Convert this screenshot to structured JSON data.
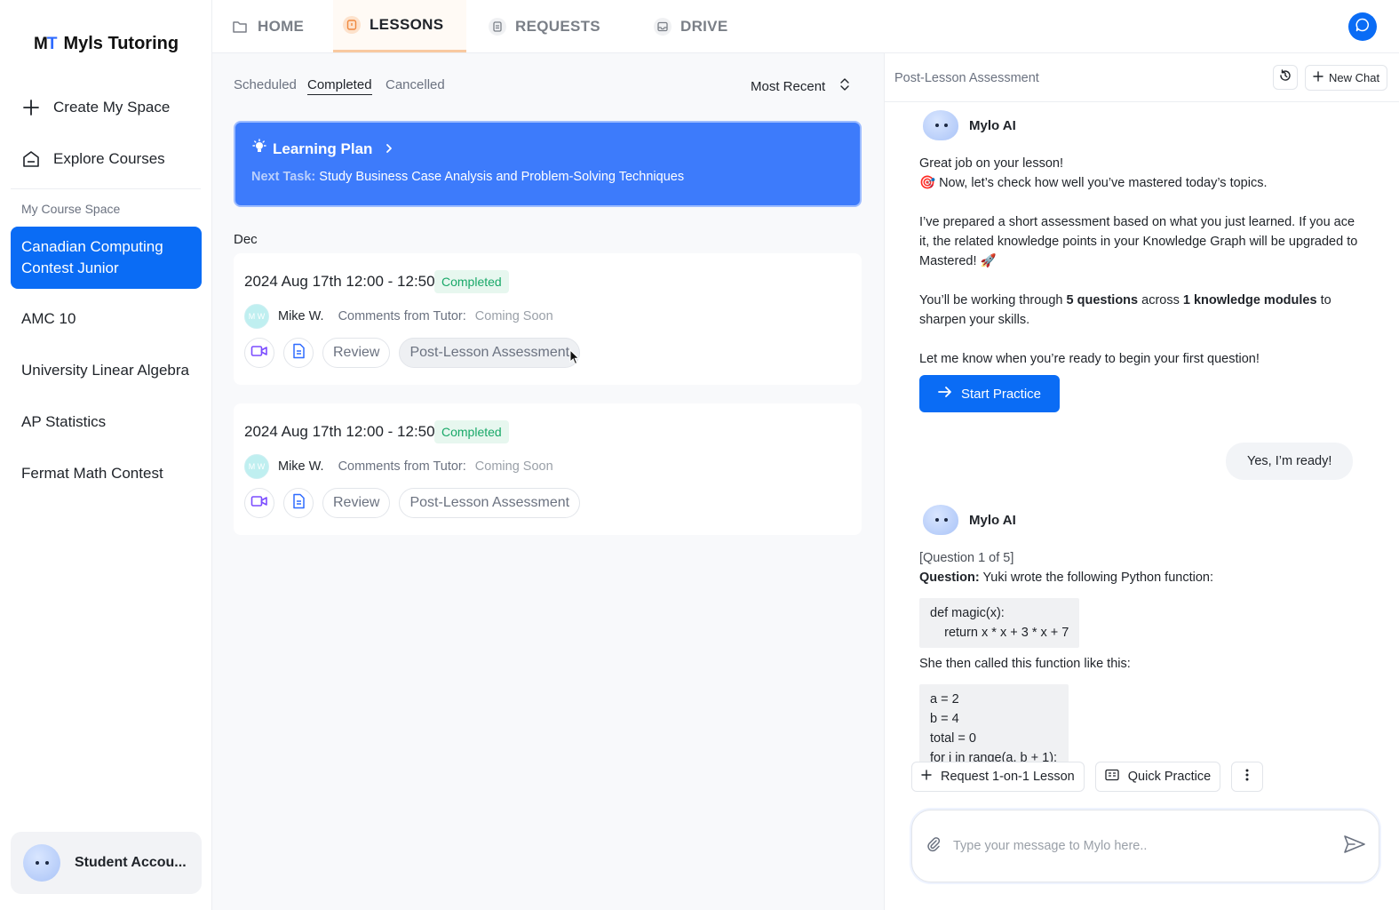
{
  "app": {
    "logo_mark": "M",
    "logo_mark_accent": "T",
    "name": "Myls Tutoring"
  },
  "sidebar": {
    "create_label": "Create My Space",
    "explore_label": "Explore Courses",
    "section_label": "My Course Space",
    "courses": [
      {
        "label": "Canadian Computing Contest Junior"
      },
      {
        "label": "AMC 10"
      },
      {
        "label": "University Linear Algebra"
      },
      {
        "label": "AP Statistics"
      },
      {
        "label": "Fermat Math Contest"
      }
    ],
    "account_label": "Student Accou..."
  },
  "topnav": {
    "tabs": [
      {
        "label": "HOME"
      },
      {
        "label": "LESSONS"
      },
      {
        "label": "REQUESTS"
      },
      {
        "label": "DRIVE"
      }
    ]
  },
  "lessons": {
    "filters": [
      {
        "label": "Scheduled"
      },
      {
        "label": "Completed"
      },
      {
        "label": "Cancelled"
      }
    ],
    "sort_label": "Most Recent",
    "plan": {
      "title": "Learning Plan",
      "next_label": "Next Task:",
      "next_task": "Study Business Case Analysis and Problem-Solving Techniques"
    },
    "month": "Dec",
    "cards": [
      {
        "date": "2024 Aug 17th 12:00 - 12:50",
        "status": "Completed",
        "tutor_initials": "M W",
        "tutor": "Mike W.",
        "comments_label": "Comments from Tutor:",
        "comments_value": "Coming Soon",
        "review_label": "Review",
        "assessment_label": "Post-Lesson Assessment"
      },
      {
        "date": "2024 Aug 17th 12:00 - 12:50",
        "status": "Completed",
        "tutor_initials": "M W",
        "tutor": "Mike W.",
        "comments_label": "Comments from Tutor:",
        "comments_value": "Coming Soon",
        "review_label": "Review",
        "assessment_label": "Post-Lesson Assessment"
      }
    ]
  },
  "chat": {
    "title": "Post-Lesson Assessment",
    "new_chat_label": "New Chat",
    "bot_name": "Mylo AI",
    "msg1": {
      "line1": "Great job on your lesson!",
      "line2": "🎯 Now, let’s check how well you’ve mastered today’s topics.",
      "para2": "I’ve prepared a short assessment based on what you just learned. If you ace it, the related knowledge points in your Knowledge Graph will be upgraded to Mastered! 🚀",
      "p3_a": "You’ll be working through ",
      "p3_b": "5 questions",
      "p3_c": " across ",
      "p3_d": "1 knowledge modules",
      "p3_e": " to sharpen your skills.",
      "para4": "Let me know when you’re ready to begin your first question!"
    },
    "start_label": "Start Practice",
    "user_reply": "Yes, I’m ready!",
    "msg2": {
      "counter": "[Question 1 of 5]",
      "q_label": "Question:",
      "q_text": " Yuki wrote the following Python function:",
      "code1": "def magic(x):\n    return x * x + 3 * x + 7",
      "then_text": "She then called this function like this:",
      "code2": "a = 2\nb = 4\ntotal = 0\nfor i in range(a, b + 1):"
    },
    "chips": [
      {
        "label": "Request 1-on-1 Lesson"
      },
      {
        "label": "Quick Practice"
      }
    ],
    "input_placeholder": "Type your message to Mylo here.."
  }
}
